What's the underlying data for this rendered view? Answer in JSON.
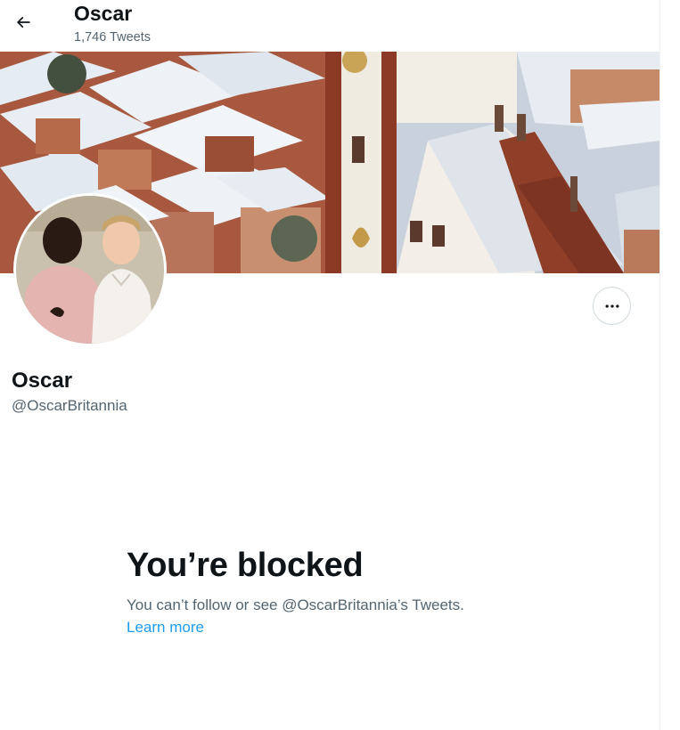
{
  "header": {
    "title": "Oscar",
    "tweet_count": "1,746 Tweets",
    "back_icon": "arrow-left-icon"
  },
  "banner": {
    "description": "snowy-rooftops-town-photo"
  },
  "avatar": {
    "description": "profile-photo"
  },
  "profile": {
    "display_name": "Oscar",
    "handle": "@OscarBritannia",
    "more_icon": "ellipsis-icon"
  },
  "blocked": {
    "title": "You’re blocked",
    "message": "You can’t follow or see @OscarBritannia’s Tweets.",
    "link_label": "Learn more"
  },
  "colors": {
    "text_primary": "#0f1419",
    "text_secondary": "#536471",
    "link": "#1d9bf0",
    "border": "#cfd9de"
  }
}
